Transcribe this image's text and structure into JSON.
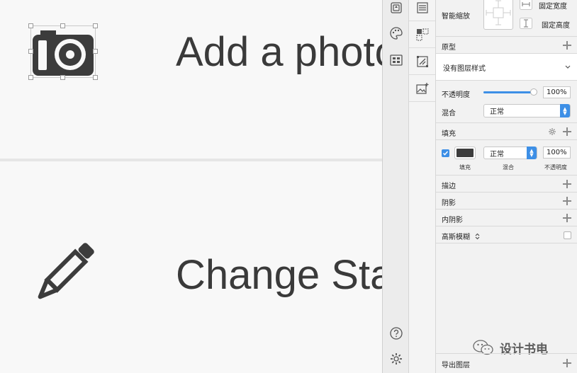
{
  "canvas": {
    "row1_title": "Add a photo",
    "row2_title": "Change Sta"
  },
  "toolbar_left": {
    "tools": [
      "symbol-icon",
      "palette-icon",
      "layout-icon"
    ],
    "bottom": [
      "help-icon",
      "gear-icon"
    ]
  },
  "toolbar_right": {
    "tools": [
      "align-icon",
      "grid-icon",
      "transform-icon",
      "image-icon"
    ]
  },
  "inspector": {
    "resizing": {
      "label": "智能缩放",
      "fix_width": "固定宽度",
      "fix_height": "固定高度"
    },
    "prototype": {
      "label": "原型",
      "layer_style": "没有图层样式"
    },
    "opacity": {
      "label": "不透明度",
      "value": "100%",
      "level": 1.0
    },
    "blend": {
      "label": "混合",
      "value": "正常"
    },
    "fill": {
      "label": "填充",
      "color": "#3c3c3c",
      "blend_value": "正常",
      "opacity_value": "100%",
      "caption_fill": "填充",
      "caption_blend": "混合",
      "caption_opacity": "不透明度"
    },
    "border": {
      "label": "描边"
    },
    "shadow": {
      "label": "阴影"
    },
    "inner_shadow": {
      "label": "内阴影"
    },
    "blur": {
      "label": "高斯模糊"
    },
    "watermark": "设计书电",
    "export": {
      "label": "导出图层"
    }
  },
  "colors": {
    "accent": "#3d8fe6",
    "icon_dark": "#3c3c3c"
  }
}
